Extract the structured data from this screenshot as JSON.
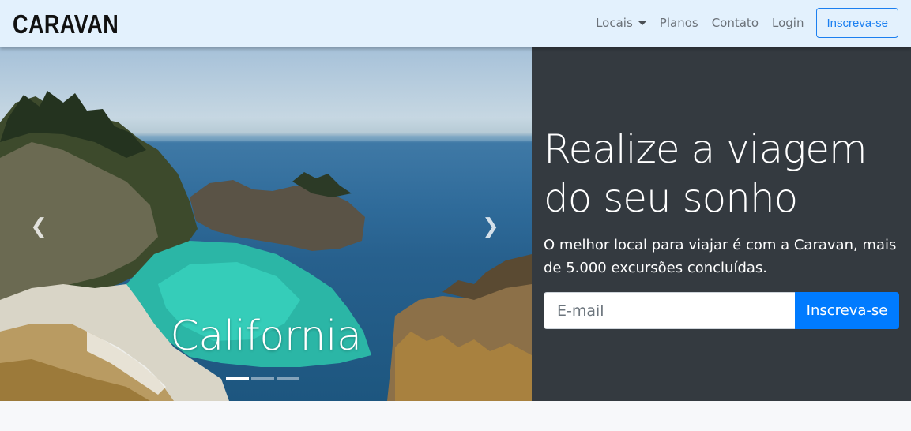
{
  "navbar": {
    "brand": "CARAVAN",
    "links": [
      {
        "label": "Locais",
        "dropdown": true
      },
      {
        "label": "Planos"
      },
      {
        "label": "Contato"
      },
      {
        "label": "Login"
      }
    ],
    "cta_label": "Inscreva-se"
  },
  "carousel": {
    "caption": "California",
    "prev_icon": "chevron-left-icon",
    "next_icon": "chevron-right-icon",
    "active_slide": 1,
    "slide_count": 3
  },
  "signup": {
    "headline": "Realize a viagem do seu sonho",
    "lead": "O melhor local para viajar é com a Caravan, mais de 5.000 excursões concluídas.",
    "email_placeholder": "E-mail",
    "submit_label": "Inscreva-se"
  },
  "colors": {
    "navbar_bg": "#e3f1fd",
    "panel_bg": "#343a40",
    "primary": "#007bff",
    "outline_primary": "#1b7ff0"
  }
}
